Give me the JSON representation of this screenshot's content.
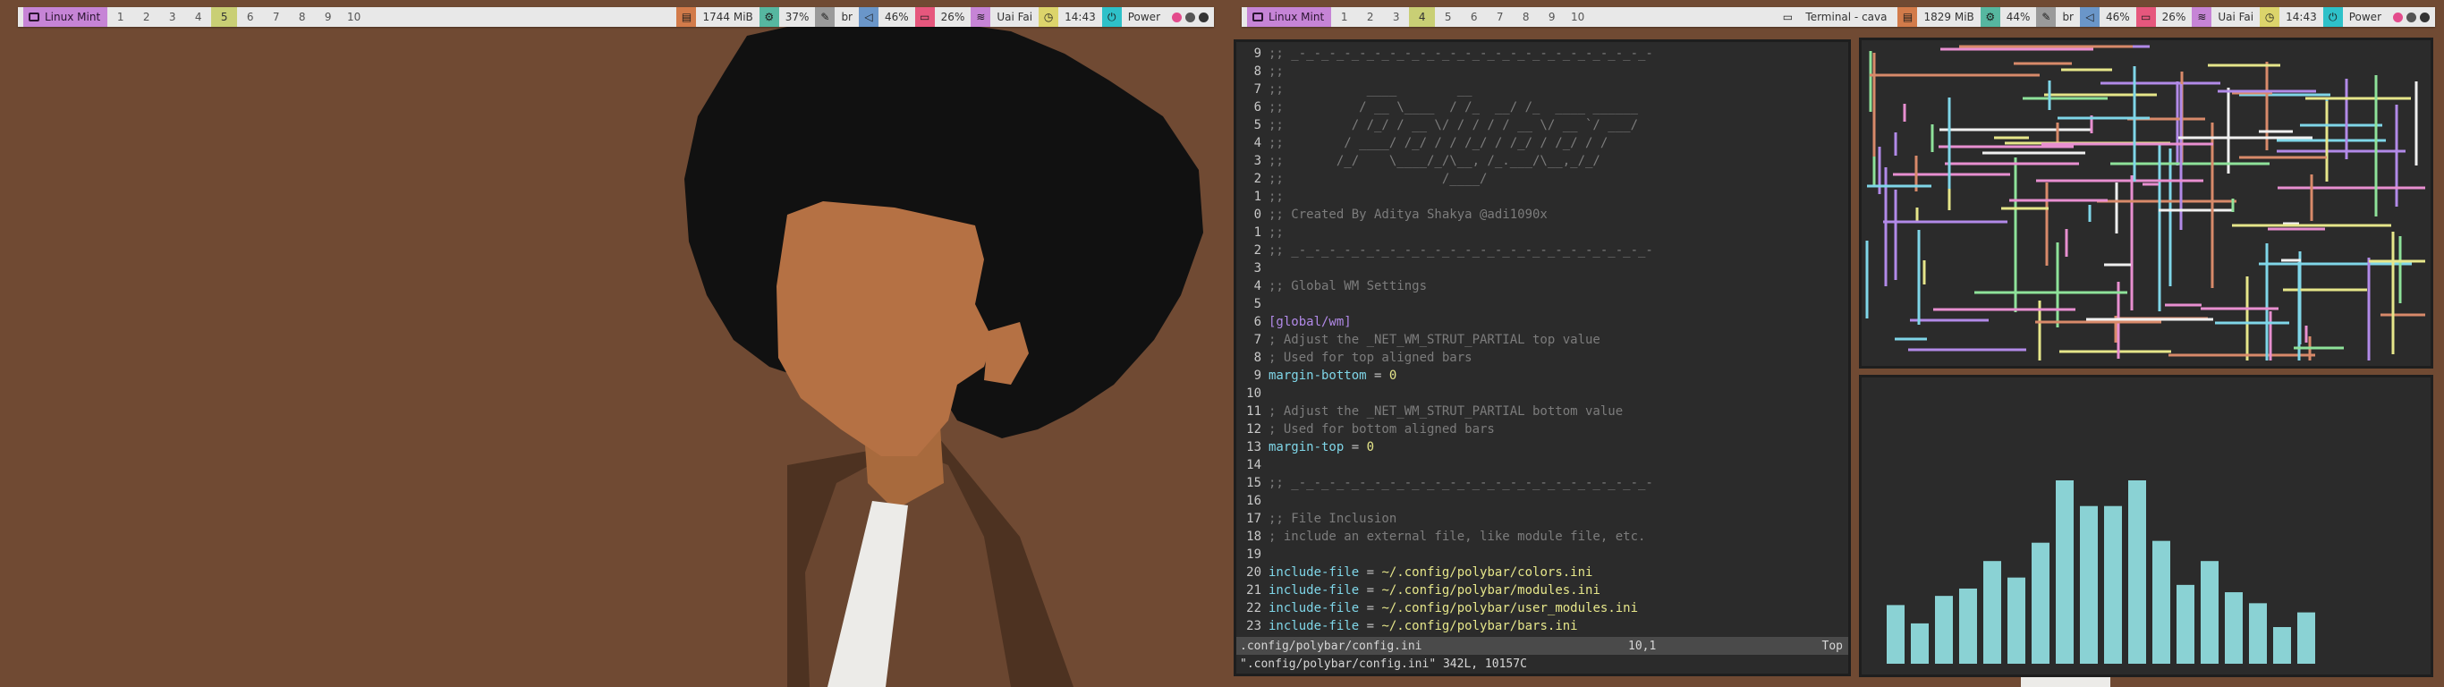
{
  "left_bar": {
    "distro_label": "Linux Mint",
    "workspaces": [
      "1",
      "2",
      "3",
      "4",
      "5",
      "6",
      "7",
      "8",
      "9",
      "10"
    ],
    "active_workspace": "5",
    "memory": "1744 MiB",
    "cpu": "37%",
    "keyboard_layout": "br",
    "volume": "46%",
    "battery": "26%",
    "wifi": "Uai Fai",
    "time": "14:43",
    "power_label": "Power"
  },
  "right_bar": {
    "distro_label": "Linux Mint",
    "workspaces": [
      "1",
      "2",
      "3",
      "4",
      "5",
      "6",
      "7",
      "8",
      "9",
      "10"
    ],
    "active_workspace": "4",
    "window_title": "Terminal - cava",
    "memory": "1829 MiB",
    "cpu": "44%",
    "keyboard_layout": "br",
    "volume": "46%",
    "battery": "26%",
    "wifi": "Uai Fai",
    "time": "14:43",
    "power_label": "Power"
  },
  "colors": {
    "wallpaper": "#704a33",
    "accent_purple": "#c684d6",
    "accent_green": "#56b7a0",
    "accent_blue": "#6a96c9",
    "accent_pink": "#e6577d",
    "accent_yellow": "#dcd46b",
    "accent_cyan": "#2ec1c9",
    "cava_bar": "#8ad2d4"
  },
  "vim": {
    "lines": [
      {
        "num": "9",
        "text": ";; _-_-_-_-_-_-_-_-_-_-_-_-_-_-_-_-_-_-_-_-_-_-_-_-",
        "cls": "c-com"
      },
      {
        "num": "8",
        "text": ";;",
        "cls": "c-com"
      },
      {
        "num": "7",
        "text": ";;           ____        __",
        "cls": "c-com"
      },
      {
        "num": "6",
        "text": ";;          / __ \\____  / /_  __/ /_  ____ ______",
        "cls": "c-com"
      },
      {
        "num": "5",
        "text": ";;         / /_/ / __ \\/ / / / / __ \\/ __ `/ ___/",
        "cls": "c-com"
      },
      {
        "num": "4",
        "text": ";;        / ____/ /_/ / / /_/ / /_/ / /_/ / /",
        "cls": "c-com"
      },
      {
        "num": "3",
        "text": ";;       /_/    \\____/_/\\__, /_.___/\\__,_/_/",
        "cls": "c-com"
      },
      {
        "num": "2",
        "text": ";;                     /____/",
        "cls": "c-com"
      },
      {
        "num": "1",
        "text": ";;",
        "cls": "c-com"
      },
      {
        "num": "0",
        "text": ";; Created By Aditya Shakya @adi1090x",
        "cls": "c-com"
      },
      {
        "num": "1",
        "text": ";;",
        "cls": "c-com"
      },
      {
        "num": "2",
        "text": ";; _-_-_-_-_-_-_-_-_-_-_-_-_-_-_-_-_-_-_-_-_-_-_-_-",
        "cls": "c-com"
      },
      {
        "num": "3",
        "text": "",
        "cls": "c-com"
      },
      {
        "num": "4",
        "text": ";; Global WM Settings",
        "cls": "c-com"
      },
      {
        "num": "5",
        "text": "",
        "cls": "c-com"
      },
      {
        "num": "6",
        "text": "[global/wm]",
        "cls": "c-sec"
      },
      {
        "num": "7",
        "text": "; Adjust the _NET_WM_STRUT_PARTIAL top value",
        "cls": "c-com"
      },
      {
        "num": "8",
        "text": "; Used for top aligned bars",
        "cls": "c-com"
      },
      {
        "num": "9",
        "key": "margin-bottom",
        "eq": " = ",
        "val": "0"
      },
      {
        "num": "10",
        "text": "",
        "cls": "c-com"
      },
      {
        "num": "11",
        "text": "; Adjust the _NET_WM_STRUT_PARTIAL bottom value",
        "cls": "c-com"
      },
      {
        "num": "12",
        "text": "; Used for bottom aligned bars",
        "cls": "c-com"
      },
      {
        "num": "13",
        "key": "margin-top",
        "eq": " = ",
        "val": "0"
      },
      {
        "num": "14",
        "text": "",
        "cls": "c-com"
      },
      {
        "num": "15",
        "text": ";; _-_-_-_-_-_-_-_-_-_-_-_-_-_-_-_-_-_-_-_-_-_-_-_-",
        "cls": "c-com"
      },
      {
        "num": "16",
        "text": "",
        "cls": "c-com"
      },
      {
        "num": "17",
        "text": ";; File Inclusion",
        "cls": "c-com"
      },
      {
        "num": "18",
        "text": "; include an external file, like module file, etc.",
        "cls": "c-com"
      },
      {
        "num": "19",
        "text": "",
        "cls": "c-com"
      },
      {
        "num": "20",
        "key": "include-file",
        "eq": " = ",
        "val": "~/.config/polybar/colors.ini"
      },
      {
        "num": "21",
        "key": "include-file",
        "eq": " = ",
        "val": "~/.config/polybar/modules.ini"
      },
      {
        "num": "22",
        "key": "include-file",
        "eq": " = ",
        "val": "~/.config/polybar/user_modules.ini"
      },
      {
        "num": "23",
        "key": "include-file",
        "eq": " = ",
        "val": "~/.config/polybar/bars.ini"
      }
    ],
    "status_file": ".config/polybar/config.ini",
    "status_pos": "10,1",
    "status_scroll": "Top",
    "command_line": "\".config/polybar/config.ini\" 342L, 10157C"
  },
  "cava": {
    "bar_levels": [
      0.32,
      0.22,
      0.37,
      0.41,
      0.56,
      0.47,
      0.66,
      1.0,
      0.86,
      0.86,
      1.0,
      0.67,
      0.43,
      0.56,
      0.39,
      0.33,
      0.2,
      0.28
    ]
  }
}
